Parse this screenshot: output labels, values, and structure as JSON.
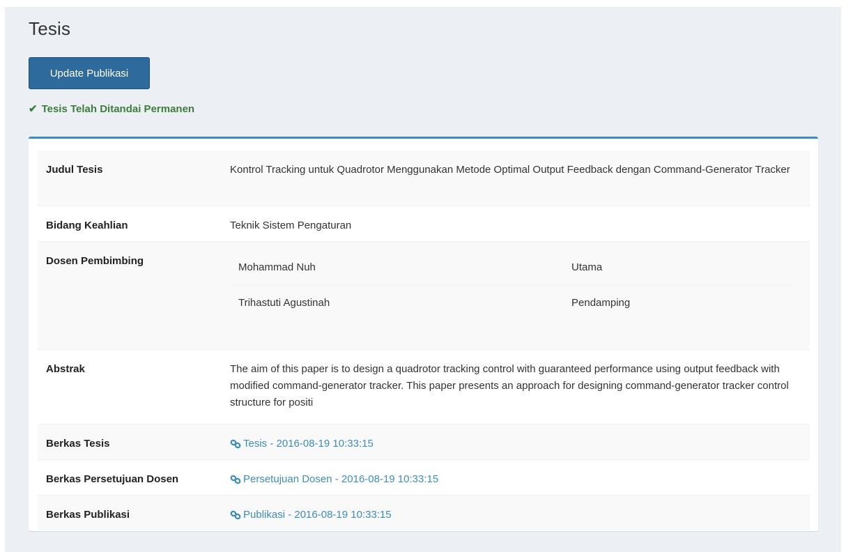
{
  "page": {
    "title": "Tesis"
  },
  "actions": {
    "update_label": "Update Publikasi"
  },
  "status": {
    "icon": "check-icon",
    "text": "Tesis Telah Ditandai Permanen",
    "color": "#3c7d3c"
  },
  "colors": {
    "accent": "#3c8dbc",
    "button": "#2f6a9c"
  },
  "detail": {
    "judul": {
      "label": "Judul Tesis",
      "value": "Kontrol Tracking untuk Quadrotor Menggunakan Metode Optimal Output Feedback dengan Command-Generator Tracker"
    },
    "bidang": {
      "label": "Bidang Keahlian",
      "value": "Teknik Sistem Pengaturan"
    },
    "dosen": {
      "label": "Dosen Pembimbing",
      "rows": [
        {
          "name": "Mohammad Nuh",
          "role": "Utama"
        },
        {
          "name": "Trihastuti Agustinah",
          "role": "Pendamping"
        }
      ]
    },
    "abstrak": {
      "label": "Abstrak",
      "value": "The aim of this paper is to design a quadrotor tracking control with guaranteed performance using output feedback with modified command-generator tracker. This paper presents an approach for designing command-generator tracker control structure for positi"
    },
    "berkas_tesis": {
      "label": "Berkas Tesis",
      "icon": "link-icon",
      "link": "Tesis - 2016-08-19 10:33:15"
    },
    "berkas_persetujuan": {
      "label": "Berkas Persetujuan Dosen",
      "icon": "link-icon",
      "link": "Persetujuan Dosen - 2016-08-19 10:33:15"
    },
    "berkas_publikasi": {
      "label": "Berkas Publikasi",
      "icon": "link-icon",
      "link": "Publikasi - 2016-08-19 10:33:15"
    }
  }
}
